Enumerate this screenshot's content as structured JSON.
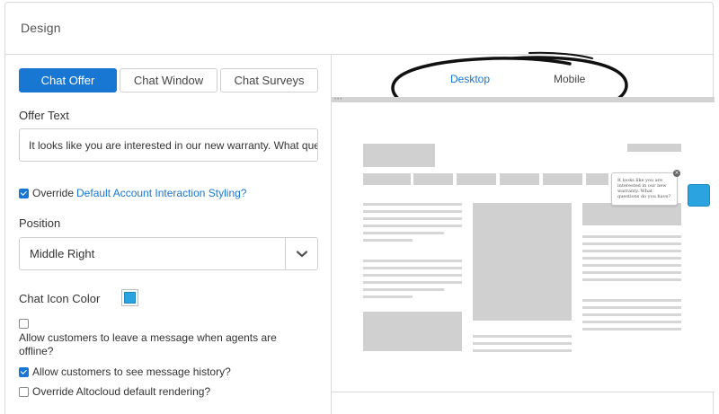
{
  "card": {
    "title": "Design"
  },
  "tabs": [
    {
      "label": "Chat Offer",
      "active": true
    },
    {
      "label": "Chat Window",
      "active": false
    },
    {
      "label": "Chat Surveys",
      "active": false
    }
  ],
  "offer_text": {
    "label": "Offer Text",
    "value": "It looks like you are interested in our new warranty. What questions do you have?"
  },
  "override_styling": {
    "checked": true,
    "label": "Override",
    "link": "Default Account Interaction Styling?"
  },
  "position": {
    "label": "Position",
    "selected": "Middle Right"
  },
  "chat_icon_color": {
    "label": "Chat Icon Color",
    "value": "#2aa3e0"
  },
  "allow_offline": {
    "checked": false,
    "label": "Allow customers to leave a message when agents are offline?"
  },
  "allow_history": {
    "checked": true,
    "label": "Allow customers to see message history?"
  },
  "override_rendering": {
    "checked": false,
    "label": "Override Altocloud default rendering?"
  },
  "preview": {
    "device_tabs": [
      {
        "label": "Desktop",
        "active": true
      },
      {
        "label": "Mobile",
        "active": false
      }
    ],
    "popup_text": "It looks like you are interested in our new warranty. What questions do you have?",
    "close_glyph": "×",
    "browser_dots": "•••"
  },
  "icons": {
    "select_chevron": "chevron-down-icon",
    "check": "check-icon",
    "close": "close-icon"
  },
  "colors": {
    "accent": "#1877d2",
    "chat_icon": "#2aa3e0"
  }
}
